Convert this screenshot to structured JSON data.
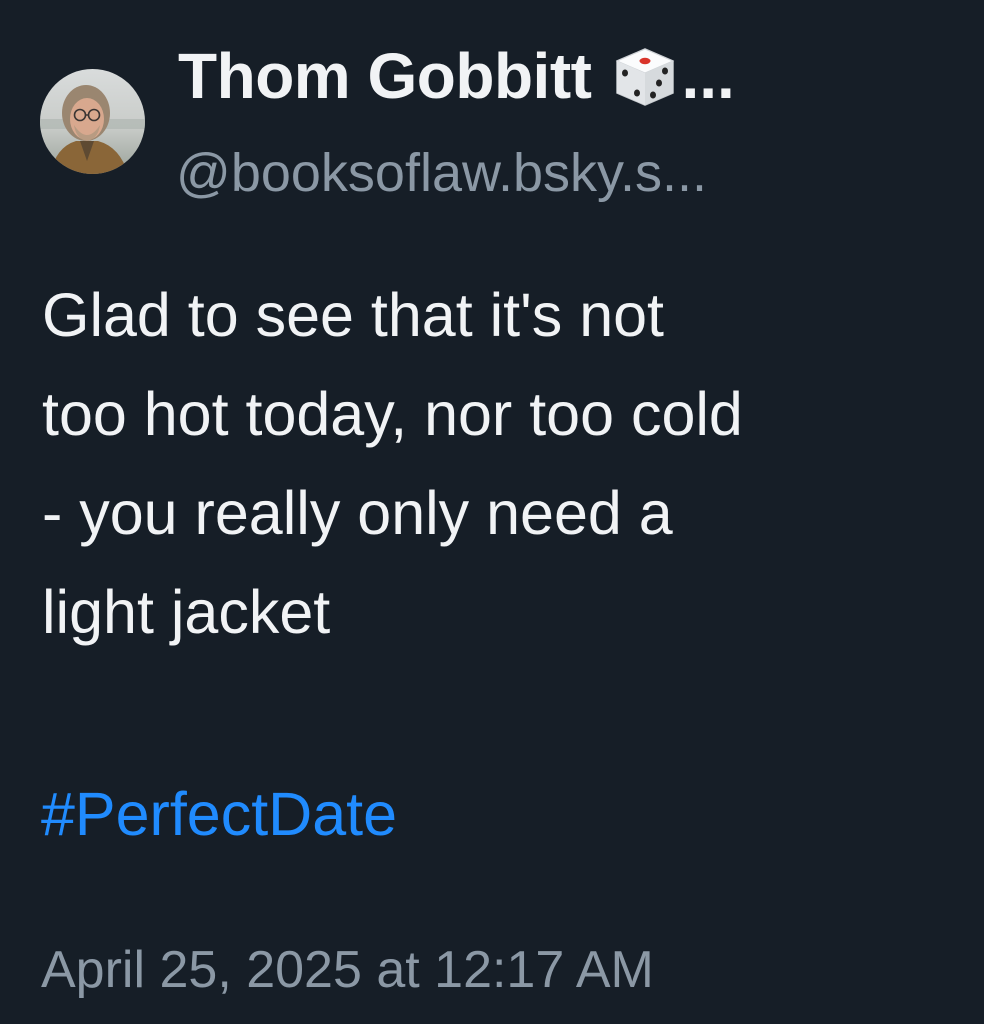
{
  "author": {
    "display_name": "Thom Gobbitt",
    "name_emoji_icon": "game-die-icon",
    "name_truncation": "...",
    "handle": "@booksoflaw.bsky.s...",
    "avatar_icon": "profile-photo"
  },
  "post": {
    "text_lines": [
      "Glad to see that it's not",
      "too hot today, nor too cold",
      "- you really only need a",
      "light jacket"
    ],
    "hashtag": "#PerfectDate",
    "timestamp": "April 25, 2025 at 12:17 AM"
  },
  "colors": {
    "background": "#161e27",
    "text": "#f1f3f5",
    "secondary_text": "#8b98a5",
    "link": "#208bfe"
  }
}
